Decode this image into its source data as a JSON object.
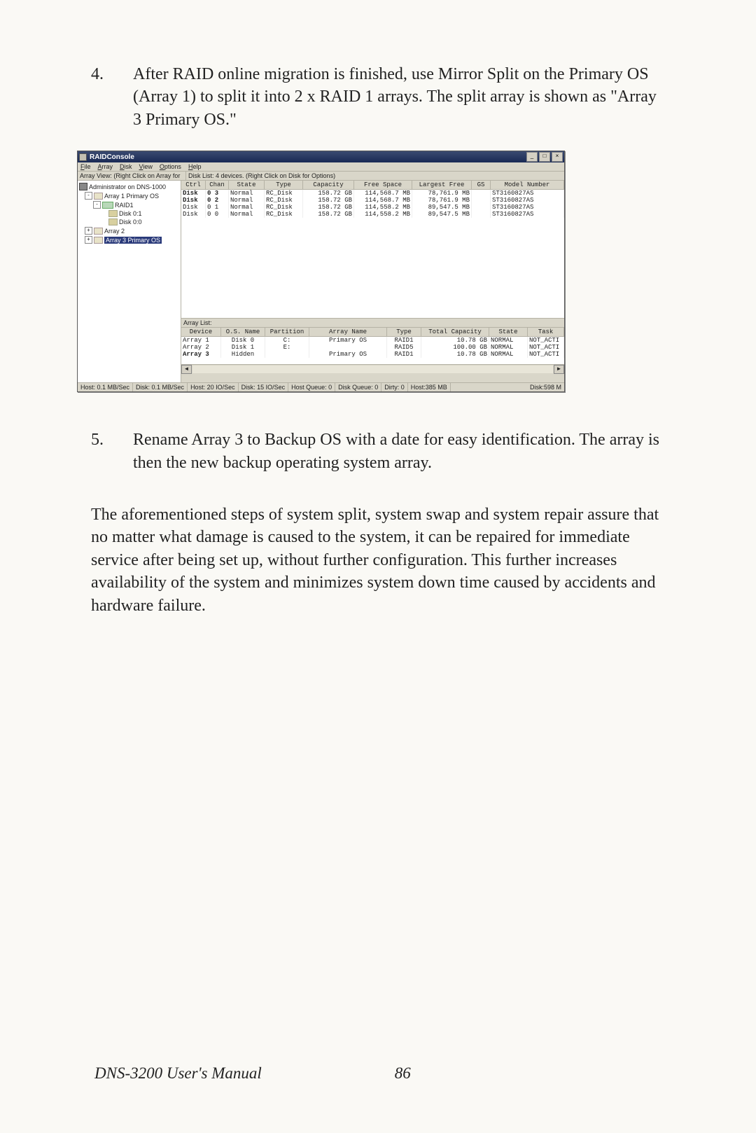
{
  "step4": {
    "num": "4.",
    "text": "After RAID online migration is finished, use Mirror Split on the Primary OS (Array 1) to split it into 2 x RAID 1 arrays. The split array is shown as \"Array 3 Primary OS.\""
  },
  "step5": {
    "num": "5.",
    "text": "Rename Array 3 to Backup OS with a date for easy identification. The array is then the new backup operating system array."
  },
  "paragraph": "The aforementioned steps of system split, system swap and system repair assure that no matter what damage is caused to the system, it can be repaired for immediate service after being set up, without further configuration. This further increases availability of the system and minimizes system down time caused by accidents and hardware failure.",
  "footer": {
    "title": "DNS-3200 User's Manual",
    "page": "86"
  },
  "win": {
    "title": "RAIDConsole",
    "menus": [
      "File",
      "Array",
      "Disk",
      "View",
      "Options",
      "Help"
    ],
    "leftLabel": "Array View: (Right Click on Array for",
    "rightLabel": "Disk List: 4 devices.  (Right Click on Disk for Options)",
    "tree": {
      "root": "Administrator on DNS-1000",
      "a1": "Array 1  Primary OS",
      "raid1": "RAID1",
      "d01": "Disk 0:1",
      "d00": "Disk 0:0",
      "a2": "Array 2",
      "a3": "Array 3  Primary OS"
    },
    "diskHeaders": [
      "Ctrl",
      "Chan",
      "State",
      "Type",
      "Capacity",
      "Free Space",
      "Largest Free",
      "GS",
      "Model Number"
    ],
    "disks": [
      {
        "ctrl": "Disk",
        "chan": "0 3",
        "state": "Normal",
        "type": "RC_Disk",
        "cap": "158.72 GB",
        "free": "114,568.7 MB",
        "lfree": "78,761.9 MB",
        "gs": "",
        "model": "ST3160827AS",
        "bold": true
      },
      {
        "ctrl": "Disk",
        "chan": "0 2",
        "state": "Normal",
        "type": "RC_Disk",
        "cap": "158.72 GB",
        "free": "114,568.7 MB",
        "lfree": "78,761.9 MB",
        "gs": "",
        "model": "ST3160827AS",
        "bold": true
      },
      {
        "ctrl": "Disk",
        "chan": "0 1",
        "state": "Normal",
        "type": "RC_Disk",
        "cap": "158.72 GB",
        "free": "114,558.2 MB",
        "lfree": "89,547.5 MB",
        "gs": "",
        "model": "ST3160827AS",
        "bold": false
      },
      {
        "ctrl": "Disk",
        "chan": "0 0",
        "state": "Normal",
        "type": "RC_Disk",
        "cap": "158.72 GB",
        "free": "114,558.2 MB",
        "lfree": "89,547.5 MB",
        "gs": "",
        "model": "ST3160827AS",
        "bold": false
      }
    ],
    "arrayListLabel": "Array List:",
    "arrayHeaders": [
      "Device",
      "O.S. Name",
      "Partition",
      "Array Name",
      "Type",
      "Total Capacity",
      "State",
      "Task"
    ],
    "arrays": [
      {
        "dev": "Array 1",
        "os": "Disk 0",
        "part": "C:",
        "name": "Primary OS",
        "type": "RAID1",
        "cap": "10.78 GB",
        "state": "NORMAL",
        "task": "NOT_ACTI",
        "bold": false
      },
      {
        "dev": "Array 2",
        "os": "Disk 1",
        "part": "E:",
        "name": "",
        "type": "RAID5",
        "cap": "100.00 GB",
        "state": "NORMAL",
        "task": "NOT_ACTI",
        "bold": false
      },
      {
        "dev": "Array 3",
        "os": "Hidden",
        "part": "",
        "name": "Primary OS",
        "type": "RAID1",
        "cap": "10.78 GB",
        "state": "NORMAL",
        "task": "NOT_ACTI",
        "bold": true
      }
    ],
    "status": [
      "Host: 0.1 MB/Sec",
      "Disk: 0.1 MB/Sec",
      "Host: 20 IO/Sec",
      "Disk: 15 IO/Sec",
      "Host Queue: 0",
      "Disk Queue: 0",
      "Dirty: 0",
      "Host:385 MB",
      "Disk:598 M"
    ]
  }
}
